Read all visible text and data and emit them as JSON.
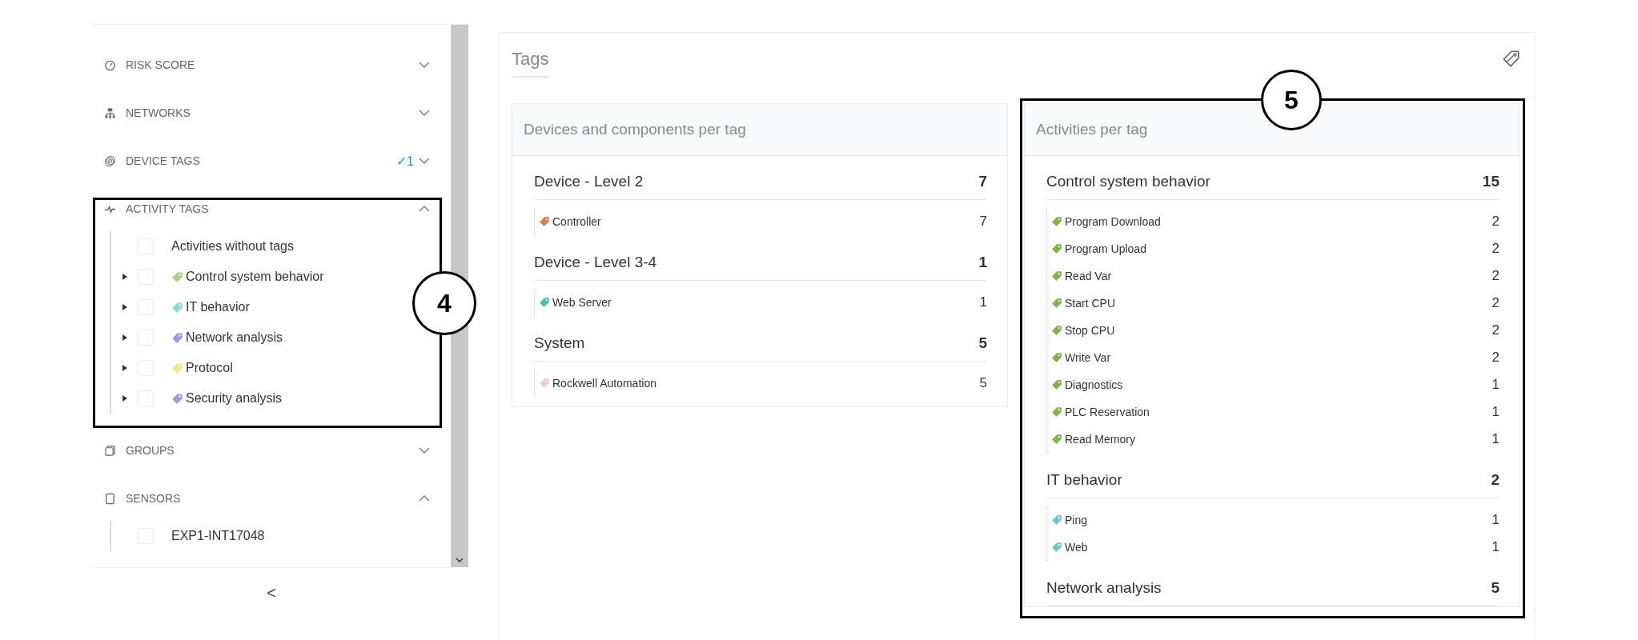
{
  "sidebar": {
    "sections": [
      {
        "label": "RISK SCORE",
        "kind": "gauge",
        "expanded": false
      },
      {
        "label": "NETWORKS",
        "kind": "network",
        "expanded": false
      },
      {
        "label": "DEVICE TAGS",
        "kind": "tags",
        "expanded": false,
        "badge": "✓1"
      },
      {
        "label": "ACTIVITY TAGS",
        "kind": "pulse",
        "expanded": true,
        "items": [
          {
            "label": "Activities without tags",
            "kind": "plain",
            "checked": false
          },
          {
            "label": "Control system behavior",
            "kind": "tag",
            "checked": false,
            "color": "#a6d28a"
          },
          {
            "label": "IT behavior",
            "kind": "tag",
            "checked": false,
            "color": "#8fd6dc"
          },
          {
            "label": "Network analysis",
            "kind": "tag",
            "checked": false,
            "color": "#a597d8"
          },
          {
            "label": "Protocol",
            "kind": "tag",
            "checked": false,
            "color": "#f3e782"
          },
          {
            "label": "Security analysis",
            "kind": "tag",
            "checked": false,
            "color": "#a597d8"
          }
        ]
      },
      {
        "label": "GROUPS",
        "kind": "groups",
        "expanded": false
      },
      {
        "label": "SENSORS",
        "kind": "sensor",
        "expanded": true,
        "items": [
          {
            "label": "EXP1-INT17048",
            "kind": "plain",
            "checked": false
          }
        ]
      }
    ],
    "collapse_button": "<"
  },
  "main": {
    "title": "Tags",
    "cards": [
      {
        "title": "Devices and components per tag",
        "groups": [
          {
            "name": "Device - Level 2",
            "count": "7",
            "items": [
              {
                "label": "Controller",
                "count": "7",
                "color": "#e07b4a"
              }
            ]
          },
          {
            "name": "Device - Level 3-4",
            "count": "1",
            "items": [
              {
                "label": "Web Server",
                "count": "1",
                "color": "#4fb8c4"
              }
            ]
          },
          {
            "name": "System",
            "count": "5",
            "items": [
              {
                "label": "Rockwell Automation",
                "count": "5",
                "color": "#f4c6d6"
              }
            ]
          }
        ]
      },
      {
        "title": "Activities per tag",
        "groups": [
          {
            "name": "Control system behavior",
            "count": "15",
            "items": [
              {
                "label": "Program Download",
                "count": "2",
                "color": "#7ab648"
              },
              {
                "label": "Program Upload",
                "count": "2",
                "color": "#7ab648"
              },
              {
                "label": "Read Var",
                "count": "2",
                "color": "#7ab648"
              },
              {
                "label": "Start CPU",
                "count": "2",
                "color": "#7ab648"
              },
              {
                "label": "Stop CPU",
                "count": "2",
                "color": "#7ab648"
              },
              {
                "label": "Write Var",
                "count": "2",
                "color": "#7ab648"
              },
              {
                "label": "Diagnostics",
                "count": "1",
                "color": "#7ab648"
              },
              {
                "label": "PLC Reservation",
                "count": "1",
                "color": "#7ab648"
              },
              {
                "label": "Read Memory",
                "count": "1",
                "color": "#7ab648"
              }
            ]
          },
          {
            "name": "IT behavior",
            "count": "2",
            "items": [
              {
                "label": "Ping",
                "count": "1",
                "color": "#6cc8d0"
              },
              {
                "label": "Web",
                "count": "1",
                "color": "#6cc8d0"
              }
            ]
          },
          {
            "name": "Network analysis",
            "count": "5"
          }
        ]
      }
    ]
  },
  "callouts": [
    {
      "number": "4"
    },
    {
      "number": "5"
    }
  ]
}
